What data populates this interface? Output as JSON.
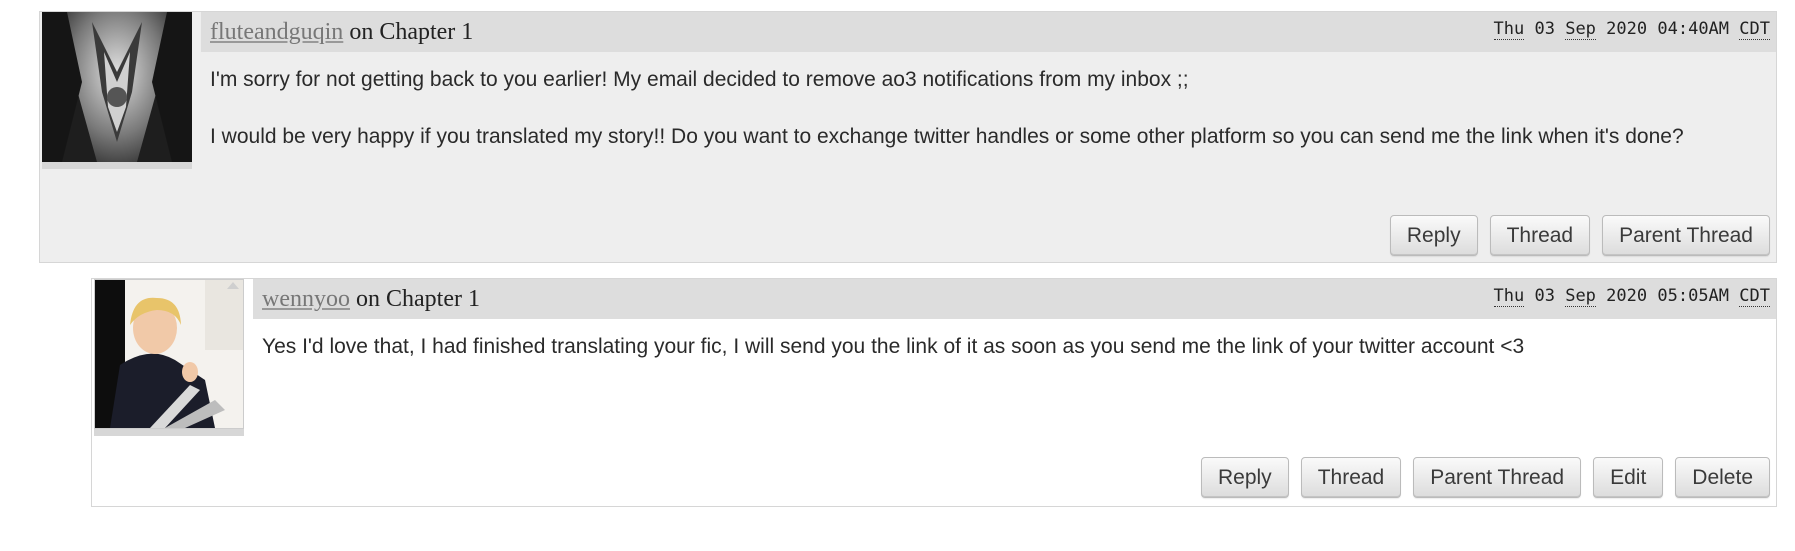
{
  "comments": [
    {
      "username": "fluteandguqin",
      "on_text": "on",
      "chapter": "Chapter 1",
      "date": {
        "day": "Thu",
        "num": "03",
        "month": "Sep",
        "year": "2020",
        "time": "04:40AM",
        "tz": "CDT"
      },
      "paragraphs": [
        "I'm sorry for not getting back to you earlier! My email decided to remove ao3 notifications from my inbox ;;",
        "I would be very happy if you translated my story!! Do you want to exchange twitter handles or some other platform so you can send me the link when it's done?"
      ],
      "actions": [
        "Reply",
        "Thread",
        "Parent Thread"
      ]
    },
    {
      "username": "wennyoo",
      "on_text": "on",
      "chapter": "Chapter 1",
      "date": {
        "day": "Thu",
        "num": "03",
        "month": "Sep",
        "year": "2020",
        "time": "05:05AM",
        "tz": "CDT"
      },
      "paragraphs": [
        "Yes I'd love that, I had finished translating your fic, I will send you the link of it as soon as you send me the link of your twitter account <3"
      ],
      "actions": [
        "Reply",
        "Thread",
        "Parent Thread",
        "Edit",
        "Delete"
      ]
    }
  ],
  "icons": {
    "avatar1": "avatar-image",
    "avatar2": "avatar-image"
  },
  "colors": {
    "comment_bg": "#eeeeee",
    "header_bg": "#dddddd",
    "username": "#777777"
  }
}
